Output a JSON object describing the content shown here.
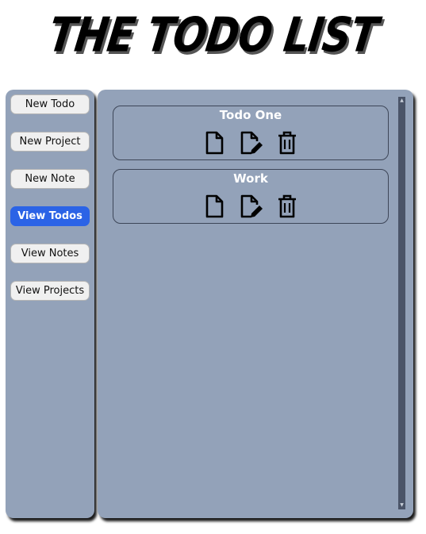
{
  "header": {
    "title": "THE TODO LIST"
  },
  "sidebar": {
    "buttons": [
      {
        "label": "New Todo",
        "active": false
      },
      {
        "label": "New Project",
        "active": false
      },
      {
        "label": "New Note",
        "active": false
      },
      {
        "label": "View Todos",
        "active": true
      },
      {
        "label": "View Notes",
        "active": false
      },
      {
        "label": "View Projects",
        "active": false
      }
    ]
  },
  "main": {
    "todos": [
      {
        "title": "Todo One",
        "actions": [
          "view-file-icon",
          "edit-file-icon",
          "trash-icon"
        ]
      },
      {
        "title": "Work",
        "actions": [
          "view-file-icon",
          "edit-file-icon",
          "trash-icon"
        ]
      }
    ]
  },
  "colors": {
    "panel": "#93a2b9",
    "active_button": "#2b63e6",
    "scrollbar": "#4a5468"
  }
}
